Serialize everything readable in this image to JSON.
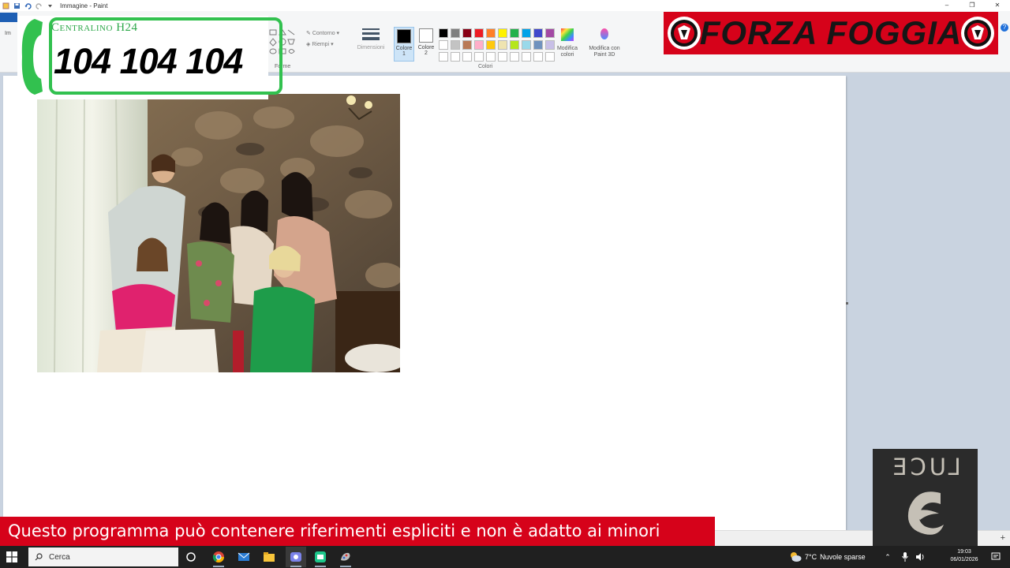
{
  "window": {
    "title": "Immagine - Paint",
    "controls": {
      "minimize": "–",
      "restore": "❐",
      "close": "✕"
    }
  },
  "ribbon": {
    "file_tab": "F",
    "left_label": "Im",
    "group_forme": "Forme",
    "contorno": "Contorno",
    "riempi": "Riempi",
    "dimensioni": "Dimensioni",
    "colore1": "Colore 1",
    "colore2": "Colore 2",
    "colori": "Colori",
    "modifica_colori": "Modifica colori",
    "modifica_paint3d": "Modifica con Paint 3D",
    "help": "?",
    "colore1_value": "#000000",
    "colore2_value": "#ffffff",
    "palette_row1": [
      "#000000",
      "#7f7f7f",
      "#880015",
      "#ed1c24",
      "#ff7f27",
      "#fff200",
      "#22b14c",
      "#00a2e8",
      "#3f48cc",
      "#a349a4"
    ],
    "palette_row2": [
      "#ffffff",
      "#c3c3c3",
      "#b97a57",
      "#ffaec9",
      "#ffc90e",
      "#efe4b0",
      "#b5e61d",
      "#99d9ea",
      "#7092be",
      "#c8bfe7"
    ],
    "palette_row3": [
      "#ffffff",
      "#ffffff",
      "#ffffff",
      "#ffffff",
      "#ffffff",
      "#ffffff",
      "#ffffff",
      "#ffffff",
      "#ffffff",
      "#ffffff"
    ]
  },
  "overlays": {
    "centralino_label": "Centralino H24",
    "centralino_number": "104 104 104",
    "forza_foggia": "FORZA FOGGIA",
    "luce": "LUCE",
    "disclaimer": "Questo programma  può contenere riferimenti espliciti e non è adatto ai minori"
  },
  "taskbar": {
    "search_placeholder": "Cerca",
    "weather_temp": "7°C",
    "weather_text": "Nuvole sparse",
    "time": "19:03",
    "date": "06/01/2026"
  },
  "status": {
    "zoom_plus": "+"
  },
  "colors": {
    "brand_red": "#d6021a",
    "centralino_green": "#32c14f",
    "canvas_bg": "#c9d3e0",
    "taskbar_bg": "#202020"
  },
  "icons": {
    "titlebar": [
      "paint-app-icon",
      "save-icon",
      "undo-icon",
      "redo-icon",
      "customize-arrow-icon"
    ],
    "taskbar": [
      "windows-start-icon",
      "search-icon",
      "cortana-icon",
      "chrome-icon",
      "mail-icon",
      "file-explorer-icon",
      "teams-icon",
      "app-icon",
      "paint-taskbar-icon"
    ],
    "tray": [
      "weather-icon",
      "chevron-up-icon",
      "microphone-icon",
      "speaker-icon",
      "notification-icon"
    ]
  }
}
